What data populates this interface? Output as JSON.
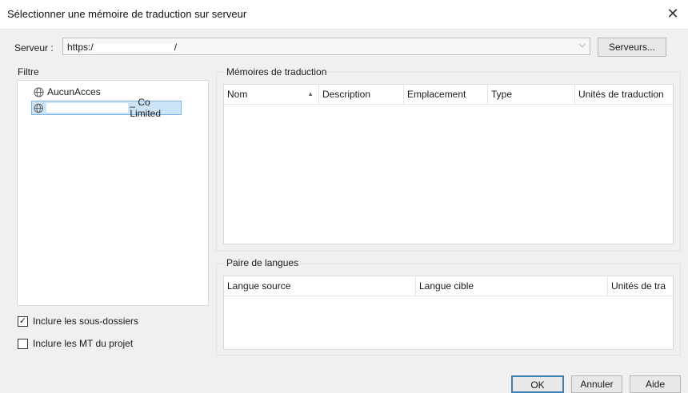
{
  "window": {
    "title": "Sélectionner une mémoire de traduction sur serveur"
  },
  "server": {
    "label": "Serveur :",
    "value": "https:/",
    "value_suffix": "/",
    "button": "Serveurs..."
  },
  "filter": {
    "label": "Filtre",
    "items": [
      {
        "label": "AucunAcces",
        "icon": "globe-icon"
      },
      {
        "label": "_ Co Limited",
        "icon": "globe-icon",
        "selected": true
      }
    ],
    "checkboxes": [
      {
        "label": "Inclure les sous-dossiers",
        "checked": true
      },
      {
        "label": "Inclure les MT du projet",
        "checked": false
      }
    ]
  },
  "memories": {
    "label": "Mémoires de traduction",
    "columns": [
      "Nom",
      "Description",
      "Emplacement",
      "Type",
      "Unités de traduction"
    ]
  },
  "languages": {
    "label": "Paire de langues",
    "columns": [
      "Langue source",
      "Langue cible",
      "Unités de tra"
    ]
  },
  "buttons": {
    "ok": "OK",
    "cancel": "Annuler",
    "help": "Aide"
  },
  "icons": {
    "close": "close-icon",
    "dropdown": "chevron-down-icon",
    "sort": "sort-ascending-icon"
  },
  "colors": {
    "selection": "#cce4f7",
    "selection_border": "#7eb4ea",
    "ok_border": "#3c7fb1"
  }
}
